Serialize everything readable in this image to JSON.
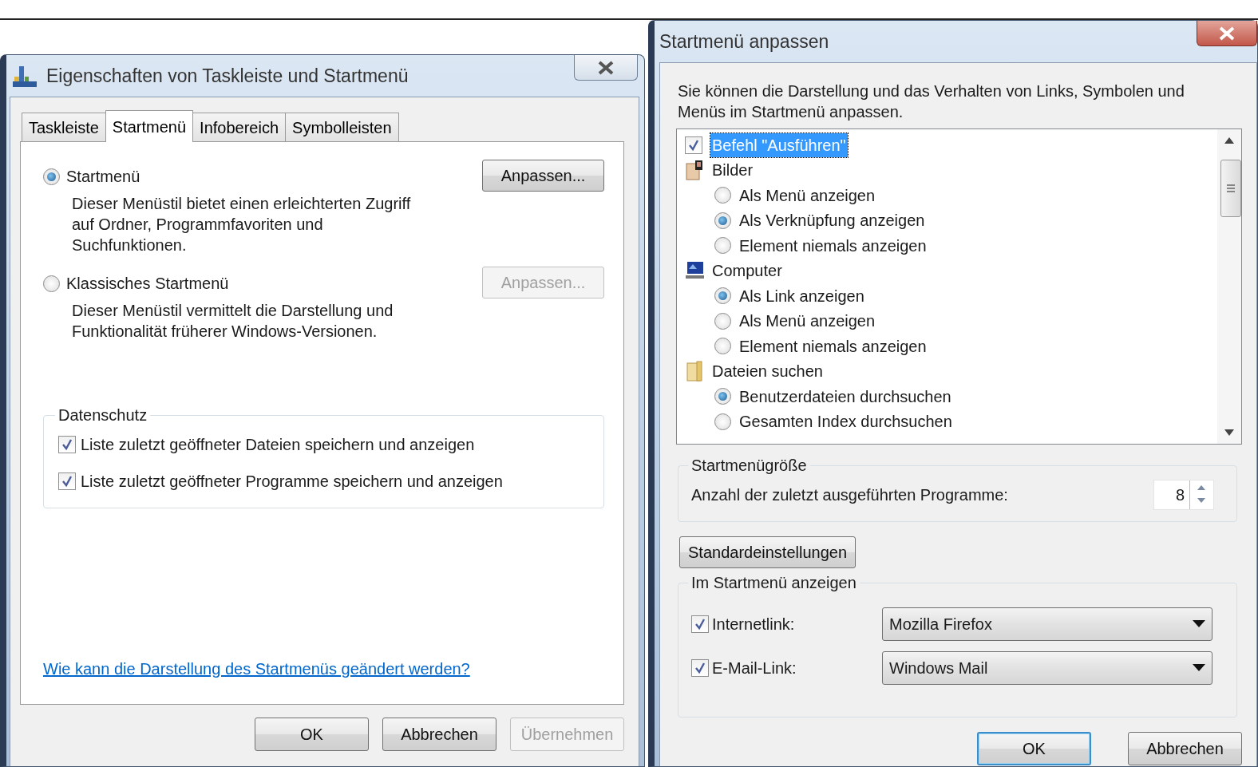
{
  "left_window": {
    "title": "Eigenschaften von Taskleiste und Startmenü",
    "tabs": [
      {
        "label": "Taskleiste",
        "selected": false
      },
      {
        "label": "Startmenü",
        "selected": true
      },
      {
        "label": "Infobereich",
        "selected": false
      },
      {
        "label": "Symbolleisten",
        "selected": false
      }
    ],
    "options": [
      {
        "label": "Startmenü",
        "selected": true,
        "description": "Dieser Menüstil bietet einen erleichterten Zugriff auf Ordner, Programmfavoriten und Suchfunktionen.",
        "button": {
          "label": "Anpassen...",
          "disabled": false
        }
      },
      {
        "label": "Klassisches Startmenü",
        "selected": false,
        "description": "Dieser Menüstil vermittelt die Darstellung und Funktionalität früherer Windows-Versionen.",
        "button": {
          "label": "Anpassen...",
          "disabled": true
        }
      }
    ],
    "privacy": {
      "legend": "Datenschutz",
      "items": [
        {
          "label": "Liste zuletzt geöffneter Dateien speichern und anzeigen",
          "checked": true
        },
        {
          "label": "Liste zuletzt geöffneter Programme speichern und anzeigen",
          "checked": true
        }
      ]
    },
    "help_link": "Wie kann die Darstellung des Startmenüs geändert werden?",
    "buttons": [
      {
        "label": "OK",
        "disabled": false
      },
      {
        "label": "Abbrechen",
        "disabled": false
      },
      {
        "label": "Übernehmen",
        "disabled": true
      }
    ]
  },
  "right_window": {
    "title": "Startmenü anpassen",
    "intro": "Sie können die Darstellung und das Verhalten von Links, Symbolen und Menüs im Startmenü anpassen.",
    "tree": [
      {
        "kind": "checkbox",
        "label": "Befehl \"Ausführen\"",
        "checked": true,
        "highlighted": true
      },
      {
        "kind": "group",
        "label": "Bilder",
        "children": [
          {
            "label": "Als Menü anzeigen",
            "selected": false
          },
          {
            "label": "Als Verknüpfung anzeigen",
            "selected": true
          },
          {
            "label": "Element niemals anzeigen",
            "selected": false
          }
        ]
      },
      {
        "kind": "group",
        "label": "Computer",
        "children": [
          {
            "label": "Als Link anzeigen",
            "selected": true
          },
          {
            "label": "Als Menü anzeigen",
            "selected": false
          },
          {
            "label": "Element niemals anzeigen",
            "selected": false
          }
        ]
      },
      {
        "kind": "group",
        "label": "Dateien suchen",
        "children": [
          {
            "label": "Benutzerdateien durchsuchen",
            "selected": true
          },
          {
            "label": "Gesamten Index durchsuchen",
            "selected": false
          }
        ]
      }
    ],
    "size_group": {
      "legend": "Startmenügröße",
      "label": "Anzahl der zuletzt ausgeführten Programme:",
      "value": "8"
    },
    "reset_button": "Standardeinstellungen",
    "show_group": {
      "legend": "Im Startmenü anzeigen",
      "items": [
        {
          "label": "Internetlink:",
          "checked": true,
          "value": "Mozilla Firefox"
        },
        {
          "label": "E-Mail-Link:",
          "checked": true,
          "value": "Windows Mail"
        }
      ]
    },
    "buttons": [
      {
        "label": "OK",
        "default": true
      },
      {
        "label": "Abbrechen",
        "default": false
      }
    ]
  }
}
